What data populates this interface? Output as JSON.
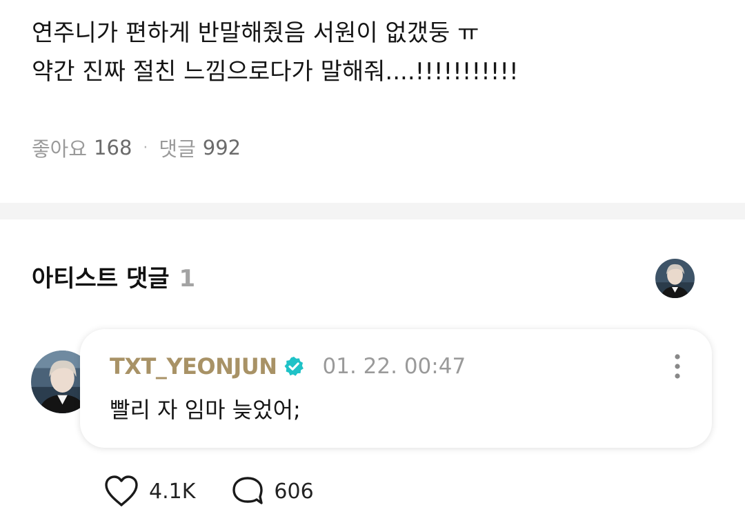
{
  "post": {
    "line1": "연주니가 편하게 반말해줬음 서원이 없갰둥 ㅠ",
    "line2": "약간 진짜 절친 느낌으로다가 말해줘....!!!!!!!!!!!"
  },
  "stats": {
    "likes_label": "좋아요",
    "likes_count": "168",
    "separator": "·",
    "comments_label": "댓글",
    "comments_count": "992"
  },
  "artist_section": {
    "title": "아티스트 댓글",
    "count": "1"
  },
  "comment": {
    "author": "TXT_YEONJUN",
    "timestamp": "01. 22. 00:47",
    "text": "빨리 자 임마 늦었어;",
    "likes": "4.1K",
    "replies": "606"
  },
  "colors": {
    "author": "#a89266",
    "verified": "#1fc2c7",
    "muted": "#9a9a9a",
    "divider": "#f4f4f4"
  },
  "icons": {
    "verified": "verified-badge-icon",
    "more": "more-vertical-icon",
    "like": "heart-icon",
    "reply": "speech-bubble-icon"
  }
}
